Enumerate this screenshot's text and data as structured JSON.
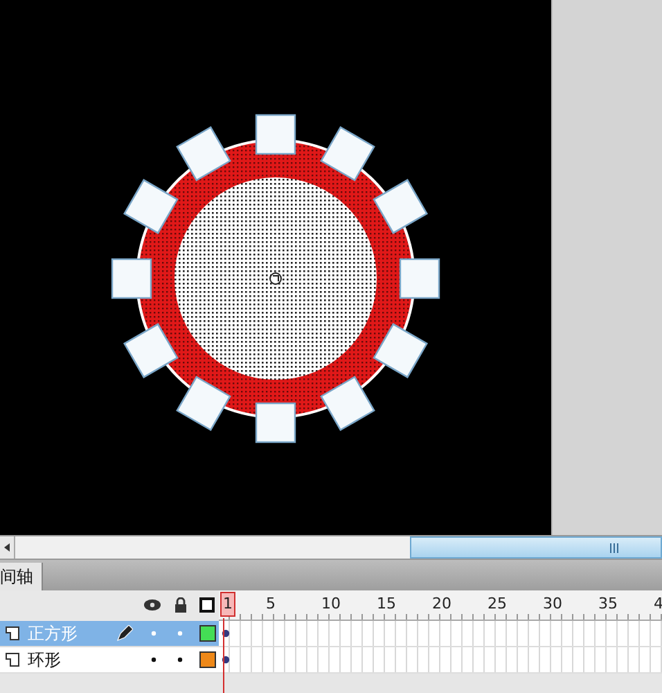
{
  "timeline": {
    "tab": "间轴",
    "frame_numbers": [
      {
        "label": "1",
        "selected": true
      },
      {
        "label": "5",
        "selected": false
      },
      {
        "label": "10",
        "selected": false
      },
      {
        "label": "15",
        "selected": false
      },
      {
        "label": "20",
        "selected": false
      },
      {
        "label": "25",
        "selected": false
      },
      {
        "label": "30",
        "selected": false
      },
      {
        "label": "35",
        "selected": false
      },
      {
        "label": "4",
        "selected": false
      }
    ],
    "layers": [
      {
        "name": "正方形",
        "selected": true,
        "editing": true,
        "visible": true,
        "locked": false,
        "color": "#44dd55"
      },
      {
        "name": "环形",
        "selected": false,
        "editing": false,
        "visible": true,
        "locked": false,
        "color": "#ee8818"
      }
    ]
  }
}
